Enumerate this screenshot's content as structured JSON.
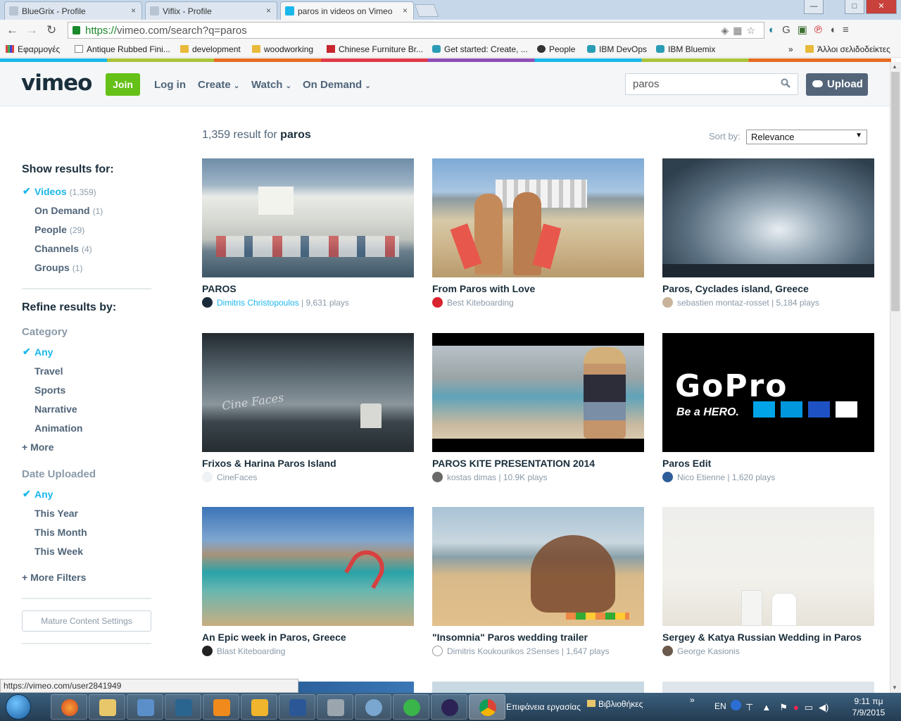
{
  "browser": {
    "tabs": [
      {
        "title": "BlueGrix - Profile",
        "close": "×"
      },
      {
        "title": "Viflix - Profile",
        "close": "×"
      },
      {
        "title": "paros in videos on Vimeo",
        "close": "×"
      }
    ],
    "window_controls": {
      "minimize": "—",
      "maximize": "□",
      "close": "✕"
    },
    "url_scheme": "https://",
    "url_rest": "vimeo.com/search?q=paros",
    "bookmarks": [
      {
        "label": "Εφαρμογές",
        "icon": "apps-grid-icon"
      },
      {
        "label": "Antique Rubbed Fini...",
        "icon": "page-icon"
      },
      {
        "label": "development",
        "icon": "folder-icon"
      },
      {
        "label": "woodworking",
        "icon": "folder-icon"
      },
      {
        "label": "Chinese Furniture Br...",
        "icon": "site-icon"
      },
      {
        "label": "Get started: Create, ...",
        "icon": "cube-icon"
      },
      {
        "label": "People",
        "icon": "github-icon"
      },
      {
        "label": "IBM DevOps",
        "icon": "cube-icon"
      },
      {
        "label": "IBM Bluemix",
        "icon": "cube-icon"
      },
      {
        "label": "»",
        "icon": ""
      },
      {
        "label": "Άλλοι σελιδοδείκτες",
        "icon": "folder-icon"
      }
    ],
    "status_url": "https://vimeo.com/user2841949"
  },
  "header": {
    "logo": "vimeo",
    "join": "Join",
    "login": "Log in",
    "nav": [
      "Create",
      "Watch",
      "On Demand"
    ],
    "search_value": "paros",
    "upload": "Upload"
  },
  "sidebar": {
    "show_results_title": "Show results for:",
    "show_results": [
      {
        "label": "Videos",
        "count": "(1,359)",
        "active": true
      },
      {
        "label": "On Demand",
        "count": "(1)",
        "active": false
      },
      {
        "label": "People",
        "count": "(29)",
        "active": false
      },
      {
        "label": "Channels",
        "count": "(4)",
        "active": false
      },
      {
        "label": "Groups",
        "count": "(1)",
        "active": false
      }
    ],
    "refine_title": "Refine results by:",
    "category_title": "Category",
    "categories": [
      {
        "label": "Any",
        "active": true
      },
      {
        "label": "Travel",
        "active": false
      },
      {
        "label": "Sports",
        "active": false
      },
      {
        "label": "Narrative",
        "active": false
      },
      {
        "label": "Animation",
        "active": false
      }
    ],
    "category_more": "+ More",
    "date_title": "Date Uploaded",
    "dates": [
      {
        "label": "Any",
        "active": true
      },
      {
        "label": "This Year",
        "active": false
      },
      {
        "label": "This Month",
        "active": false
      },
      {
        "label": "This Week",
        "active": false
      }
    ],
    "more_filters": "+ More Filters",
    "mature": "Mature Content Settings"
  },
  "results": {
    "count_text": "1,359 result for ",
    "query": "paros",
    "sort_label": "Sort by:",
    "sort_value": "Relevance",
    "sort_arrow": "▼",
    "videos": [
      {
        "title": "PAROS",
        "user": "Dimitris Christopoulos",
        "plays": " | 9,631 plays",
        "user_highlight": true
      },
      {
        "title": "From Paros with Love",
        "user": "Best Kiteboarding",
        "plays": "",
        "user_highlight": false
      },
      {
        "title": "Paros, Cyclades island, Greece",
        "user": "sebastien montaz-rosset",
        "plays": " | 5,184 plays",
        "user_highlight": false
      },
      {
        "title": "Frixos & Harina Paros Island",
        "user": "CineFaces",
        "plays": "",
        "user_highlight": false
      },
      {
        "title": "PAROS KITE PRESENTATION 2014",
        "user": "kostas dimas",
        "plays": " | 10.9K plays",
        "user_highlight": false
      },
      {
        "title": "Paros Edit",
        "user": "Nico Etienne",
        "plays": " | 1,620 plays",
        "user_highlight": false
      },
      {
        "title": "An Epic week in Paros, Greece",
        "user": "Blast Kiteboarding",
        "plays": "",
        "user_highlight": false
      },
      {
        "title": "\"Insomnia\" Paros wedding trailer",
        "user": "Dimitris Koukourikos 2Senses",
        "plays": " | 1,647 plays",
        "user_highlight": false
      },
      {
        "title": "Sergey & Katya Russian Wedding in Paros",
        "user": "George Kasionis",
        "plays": "",
        "user_highlight": false
      }
    ],
    "thumb_overlays": {
      "cine": "Cine Faces",
      "gopro": "GoPro",
      "gopro_sub": "Be a HERO."
    }
  },
  "taskbar": {
    "desktop_label": "Επιφάνεια εργασίας",
    "libraries_label": "Βιβλιοθήκες",
    "chevron": "»",
    "lang": "EN",
    "time": "9:11 πμ",
    "date": "7/9/2015"
  }
}
